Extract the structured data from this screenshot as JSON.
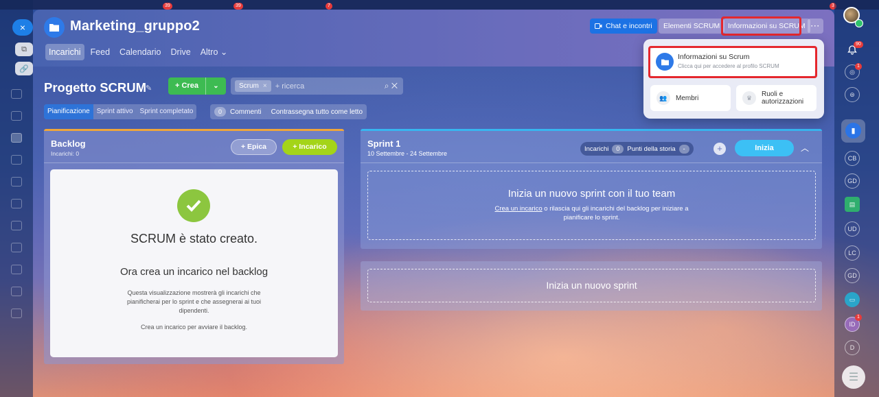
{
  "window": {
    "close": "×"
  },
  "header": {
    "title": "Marketing_gruppo2",
    "tabs": [
      {
        "label": "Incarichi"
      },
      {
        "label": "Feed"
      },
      {
        "label": "Calendario"
      },
      {
        "label": "Drive"
      },
      {
        "label": "Altro ⌄"
      }
    ],
    "buttons": {
      "chat": "Chat e incontri",
      "elements": "Elementi SCRUM",
      "info": "Informazioni su SCRUM",
      "more": "···"
    }
  },
  "dropdown": {
    "main_title": "Informazioni su Scrum",
    "main_sub": "Clicca qui per accedere al profilo SCRUM",
    "members": "Membri",
    "roles_line1": "Ruoli e",
    "roles_line2": "autorizzazioni"
  },
  "project": {
    "title": "Progetto SCRUM",
    "create_label": "+ Crea",
    "search_chip": "Scrum",
    "search_placeholder": "+ ricerca"
  },
  "subtabs": {
    "planning": "Pianificazione",
    "active": "Sprint attivo",
    "completed": "Sprint completato",
    "comments_count": "0",
    "comments": "Commenti",
    "mark_read": "Contrassegna tutto come letto"
  },
  "backlog": {
    "title": "Backlog",
    "subtitle": "Incarichi: 0",
    "epic_btn": "+ Epica",
    "task_btn": "+ Incarico",
    "card": {
      "heading": "SCRUM è stato creato.",
      "subheading": "Ora crea un incarico nel backlog",
      "desc": "Questa visualizzazione mostrerà gli incarichi che pianificherai per lo sprint e che assegnerai ai tuoi dipendenti.",
      "hint": "Crea un incarico per avviare il backlog."
    }
  },
  "sprint": {
    "title": "Sprint 1",
    "dates": "10 Settembre - 24 Settembre",
    "tasks_label": "Incarichi",
    "tasks_count": "0",
    "points_label": "Punti della storia",
    "points_value": "-",
    "start_btn": "Inizia",
    "drop_heading": "Inizia un nuovo sprint con il tuo team",
    "drop_link": "Crea un incarico",
    "drop_text": " o rilascia qui gli incarichi del backlog per iniziare a pianificare lo sprint.",
    "new_sprint": "Inizia un nuovo sprint"
  },
  "right_bar": {
    "notif_count": "90",
    "badge2": "1",
    "badge3": "1",
    "avatars": [
      "CB",
      "GD",
      "UD",
      "LC",
      "GD",
      "ID",
      "D"
    ]
  },
  "top_badges": [
    "39",
    "39",
    "7",
    "3"
  ],
  "colors": {
    "accent": "#2e7ae8",
    "green": "#3dbb52",
    "lime": "#a4d419",
    "cyan": "#3cc0f5",
    "highlight": "#e5272d"
  }
}
